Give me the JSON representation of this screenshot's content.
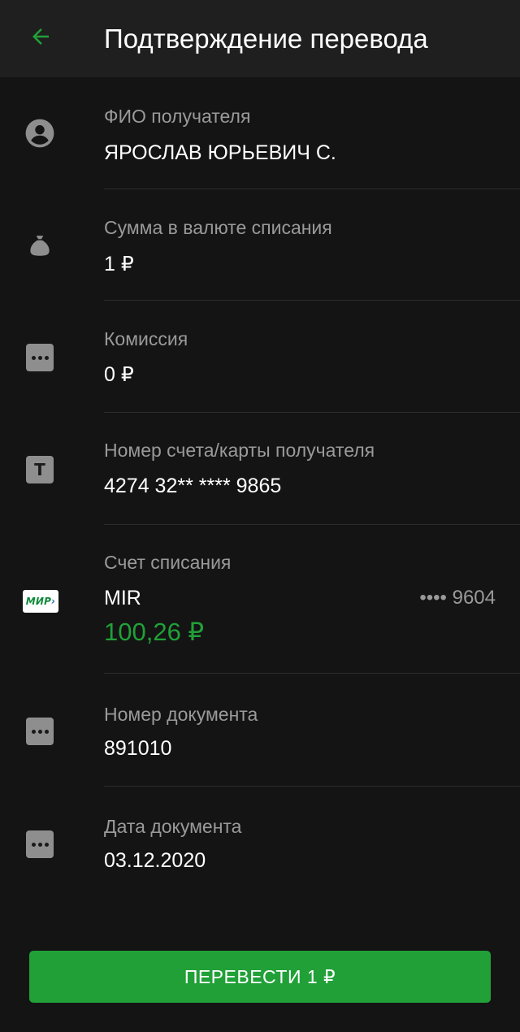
{
  "app_bar": {
    "title": "Подтверждение перевода",
    "back_icon": "arrow-left-icon"
  },
  "colors": {
    "accent": "#21a038",
    "background": "#141414",
    "app_bar": "#1f1f1f",
    "label": "#9a9a9a",
    "value": "#ffffff"
  },
  "rows": {
    "recipient": {
      "icon": "person-icon",
      "label": "ФИО получателя",
      "value": "ЯРОСЛАВ ЮРЬЕВИЧ С."
    },
    "amount": {
      "icon": "money-bag-icon",
      "label": "Сумма в валюте списания",
      "value": "1 ₽"
    },
    "commission": {
      "icon": "dots-icon",
      "label": "Комиссия",
      "value": "0 ₽"
    },
    "recipient_account": {
      "icon": "t-letter-icon",
      "label": "Номер счета/карты получателя",
      "value": "4274 32** **** 9865"
    },
    "debit_account": {
      "icon": "mir-card-icon",
      "icon_text": "МИР",
      "label": "Счет списания",
      "card_name": "MIR",
      "card_mask": "•••• 9604",
      "balance": "100,26 ₽"
    },
    "document_number": {
      "icon": "dots-icon",
      "label": "Номер документа",
      "value": "891010"
    },
    "document_date": {
      "icon": "dots-icon",
      "label": "Дата документа",
      "value": "03.12.2020"
    }
  },
  "action": {
    "transfer_label": "ПЕРЕВЕСТИ 1 ₽"
  }
}
